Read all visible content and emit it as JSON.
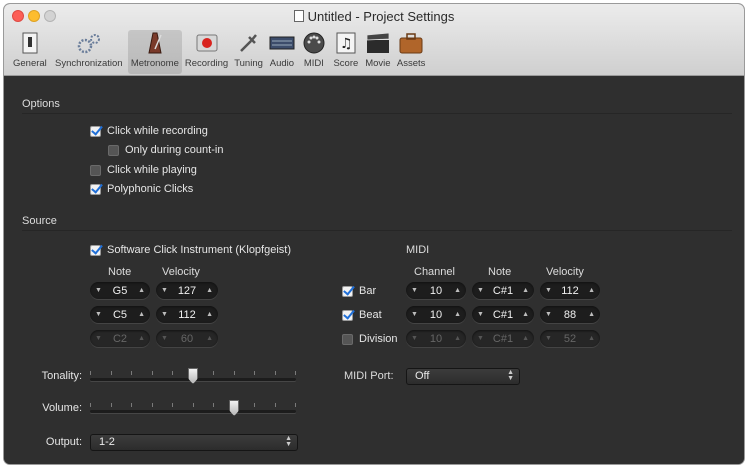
{
  "window": {
    "title": "Untitled - Project Settings"
  },
  "toolbar": {
    "items": [
      {
        "label": "General",
        "icon": "general-icon"
      },
      {
        "label": "Synchronization",
        "icon": "sync-gears-icon"
      },
      {
        "label": "Metronome",
        "icon": "metronome-icon",
        "selected": true
      },
      {
        "label": "Recording",
        "icon": "record-icon"
      },
      {
        "label": "Tuning",
        "icon": "tuning-icon"
      },
      {
        "label": "Audio",
        "icon": "audio-icon"
      },
      {
        "label": "MIDI",
        "icon": "midi-icon"
      },
      {
        "label": "Score",
        "icon": "score-icon"
      },
      {
        "label": "Movie",
        "icon": "movie-clapper-icon"
      },
      {
        "label": "Assets",
        "icon": "assets-briefcase-icon"
      }
    ]
  },
  "options": {
    "heading": "Options",
    "click_while_recording": {
      "label": "Click while recording",
      "checked": true
    },
    "only_during_count_in": {
      "label": "Only during count-in",
      "checked": false
    },
    "click_while_playing": {
      "label": "Click while playing",
      "checked": false
    },
    "polyphonic_clicks": {
      "label": "Polyphonic Clicks",
      "checked": true
    }
  },
  "source": {
    "heading": "Source",
    "software_click": {
      "label": "Software Click Instrument (Klopfgeist)",
      "checked": true
    },
    "note_header": "Note",
    "velocity_header": "Velocity",
    "rows": [
      {
        "note": "G5",
        "velocity": "127",
        "enabled": true
      },
      {
        "note": "C5",
        "velocity": "112",
        "enabled": true
      },
      {
        "note": "C2",
        "velocity": "60",
        "enabled": false
      }
    ]
  },
  "midi": {
    "heading": "MIDI",
    "channel_header": "Channel",
    "note_header": "Note",
    "velocity_header": "Velocity",
    "rows": [
      {
        "label": "Bar",
        "checked": true,
        "channel": "10",
        "note": "C#1",
        "velocity": "112"
      },
      {
        "label": "Beat",
        "checked": true,
        "channel": "10",
        "note": "C#1",
        "velocity": "88"
      },
      {
        "label": "Division",
        "checked": false,
        "channel": "10",
        "note": "C#1",
        "velocity": "52"
      }
    ],
    "port_label": "MIDI Port:",
    "port_value": "Off"
  },
  "controls": {
    "tonality_label": "Tonality:",
    "tonality_level": 0.5,
    "volume_label": "Volume:",
    "volume_level": 0.7,
    "output_label": "Output:",
    "output_value": "1-2"
  }
}
